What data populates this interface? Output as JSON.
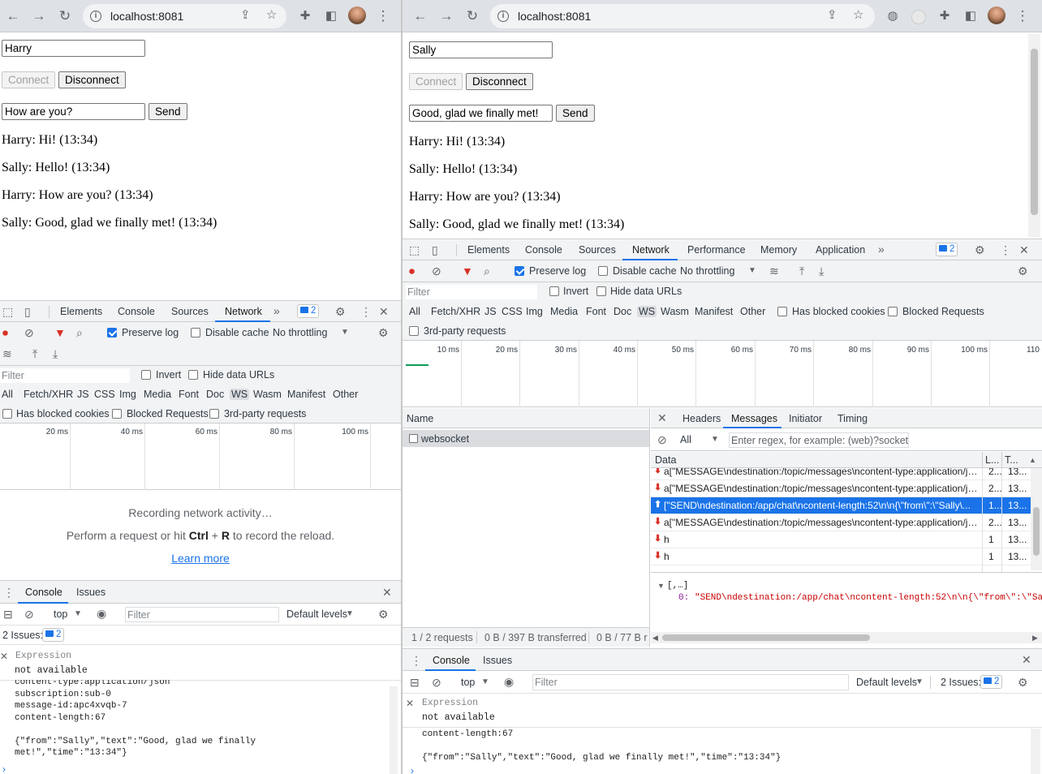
{
  "left": {
    "browser": {
      "url": "localhost:8081"
    },
    "app": {
      "name": "Harry",
      "connect_label": "Connect",
      "disconnect_label": "Disconnect",
      "message_input": "How are you?",
      "send_label": "Send",
      "messages": [
        "Harry: Hi! (13:34)",
        "Sally: Hello! (13:34)",
        "Harry: How are you? (13:34)",
        "Sally: Good, glad we finally met! (13:34)"
      ]
    },
    "devtools": {
      "tabs": [
        "Elements",
        "Console",
        "Sources",
        "Network"
      ],
      "issues_count": "2",
      "preserve_log": "Preserve log",
      "disable_cache": "Disable cache",
      "throttling": "No throttling",
      "filter_placeholder": "Filter",
      "invert": "Invert",
      "hide_data_urls": "Hide data URLs",
      "types": [
        "All",
        "Fetch/XHR",
        "JS",
        "CSS",
        "Img",
        "Media",
        "Font",
        "Doc",
        "WS",
        "Wasm",
        "Manifest",
        "Other"
      ],
      "has_blocked_cookies": "Has blocked cookies",
      "blocked_requests": "Blocked Requests",
      "third_party": "3rd-party requests",
      "ticks": [
        "20 ms",
        "40 ms",
        "60 ms",
        "80 ms",
        "100 ms"
      ],
      "recording": "Recording network activity…",
      "perform_pre": "Perform a request or hit",
      "key_ctrl": "Ctrl",
      "key_plus": "+",
      "key_r": "R",
      "perform_post": "to record the reload.",
      "learn_more": "Learn more",
      "drawer_tabs": [
        "Console",
        "Issues"
      ],
      "context": "top",
      "console_filter": "Filter",
      "default_levels": "Default levels",
      "issues_label": "2 Issues:",
      "issues_badge": "2",
      "expression": "Expression",
      "not_available": "not available",
      "console_lines": [
        "content-type:application/json",
        "subscription:sub-0",
        "message-id:apc4xvqb-7",
        "content-length:67",
        "",
        "{\"from\":\"Sally\",\"text\":\"Good, glad we finally",
        "met!\",\"time\":\"13:34\"}"
      ]
    }
  },
  "right": {
    "browser": {
      "url": "localhost:8081"
    },
    "app": {
      "name": "Sally",
      "connect_label": "Connect",
      "disconnect_label": "Disconnect",
      "message_input": "Good, glad we finally met!",
      "send_label": "Send",
      "messages": [
        "Harry: Hi! (13:34)",
        "Sally: Hello! (13:34)",
        "Harry: How are you? (13:34)",
        "Sally: Good, glad we finally met! (13:34)"
      ]
    },
    "devtools": {
      "tabs": [
        "Elements",
        "Console",
        "Sources",
        "Network",
        "Performance",
        "Memory",
        "Application"
      ],
      "issues_count": "2",
      "preserve_log": "Preserve log",
      "disable_cache": "Disable cache",
      "throttling": "No throttling",
      "filter_placeholder": "Filter",
      "invert": "Invert",
      "hide_data_urls": "Hide data URLs",
      "types": [
        "All",
        "Fetch/XHR",
        "JS",
        "CSS",
        "Img",
        "Media",
        "Font",
        "Doc",
        "WS",
        "Wasm",
        "Manifest",
        "Other"
      ],
      "has_blocked_cookies": "Has blocked cookies",
      "blocked_requests": "Blocked Requests",
      "third_party": "3rd-party requests",
      "ticks": [
        "10 ms",
        "20 ms",
        "30 ms",
        "40 ms",
        "50 ms",
        "60 ms",
        "70 ms",
        "80 ms",
        "90 ms",
        "100 ms",
        "110"
      ],
      "name_header": "Name",
      "request_name": "websocket",
      "detail_tabs": [
        "Headers",
        "Messages",
        "Initiator",
        "Timing"
      ],
      "msg_filter_select": "All",
      "msg_filter_placeholder": "Enter regex, for example: (web)?socket",
      "col_data": "Data",
      "col_length": "L...",
      "col_time": "T...",
      "messages": [
        {
          "dir": "down",
          "data": "a[\"MESSAGE\\ndestination:/topic/messages\\ncontent-type:application/js...",
          "length": "2...",
          "time": "13..."
        },
        {
          "dir": "down",
          "data": "a[\"MESSAGE\\ndestination:/topic/messages\\ncontent-type:application/js...",
          "length": "2...",
          "time": "13..."
        },
        {
          "dir": "up",
          "data": "[\"SEND\\ndestination:/app/chat\\ncontent-length:52\\n\\n{\\\"from\\\":\\\"Sally\\...",
          "length": "1...",
          "time": "13..."
        },
        {
          "dir": "down",
          "data": "a[\"MESSAGE\\ndestination:/topic/messages\\ncontent-type:application/js...",
          "length": "2...",
          "time": "13..."
        },
        {
          "dir": "down",
          "data": "h",
          "length": "1",
          "time": "13..."
        },
        {
          "dir": "down",
          "data": "h",
          "length": "1",
          "time": "13..."
        }
      ],
      "detail_tree": "[,…]",
      "detail_key": "0:",
      "detail_value": "\"SEND\\ndestination:/app/chat\\ncontent-length:52\\n\\n{\\\"from\\\":\\\"Sa",
      "status_requests": "1 / 2 requests",
      "status_transferred": "0 B / 397 B transferred",
      "status_resources": "0 B / 77 B r",
      "drawer_tabs": [
        "Console",
        "Issues"
      ],
      "context": "top",
      "console_filter": "Filter",
      "default_levels": "Default levels",
      "issues_label": "2 Issues:",
      "issues_badge": "2",
      "expression": "Expression",
      "not_available": "not available",
      "console_lines": [
        "content-length:67",
        "",
        "{\"from\":\"Sally\",\"text\":\"Good, glad we finally met!\",\"time\":\"13:34\"}"
      ]
    }
  },
  "colors": {
    "accent": "#1a73e8",
    "record_red": "#d93025",
    "devtools_bg": "#f1f3f4",
    "chrome_bg": "#dee1e6"
  }
}
